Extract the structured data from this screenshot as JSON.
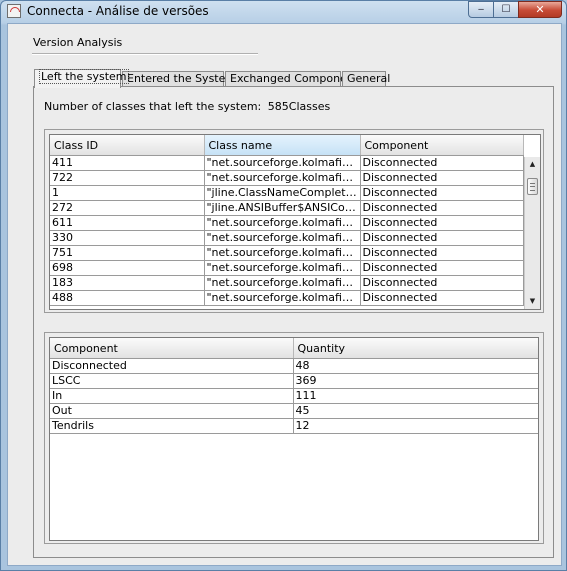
{
  "window": {
    "title": "Connecta - Análise de versões",
    "controls": {
      "minimize": "‒",
      "maximize": "☐",
      "close": "✕"
    }
  },
  "group": {
    "title": "Version Analysis"
  },
  "tabs": [
    {
      "label": "Left the system",
      "active": true
    },
    {
      "label": "Entered the System",
      "active": false
    },
    {
      "label": "Exchanged Component",
      "active": false
    },
    {
      "label": "General",
      "active": false
    }
  ],
  "summary": {
    "label": "Number of classes that left the system:",
    "value": "585Classes"
  },
  "classes_table": {
    "columns": [
      "Class ID",
      "Class name",
      "Component"
    ],
    "sorted_column": "Class name",
    "rows": [
      [
        "411",
        "\"net.sourceforge.kolmafia.Logi…",
        "Disconnected"
      ],
      [
        "722",
        "\"net.sourceforge.kolmafia.Cla…",
        "Disconnected"
      ],
      [
        "1",
        "\"jline.ClassNameCompletor\"",
        "Disconnected"
      ],
      [
        "272",
        "\"jline.ANSIBuffer$ANSICodes\"",
        "Disconnected"
      ],
      [
        "611",
        "\"net.sourceforge.kolmafia.Buff…",
        "Disconnected"
      ],
      [
        "330",
        "\"net.sourceforge.kolmafia.Adv…",
        "Disconnected"
      ],
      [
        "751",
        "\"net.sourceforge.kolmafia.Pro…",
        "Disconnected"
      ],
      [
        "698",
        "\"net.sourceforge.kolmafia.Cak…",
        "Disconnected"
      ],
      [
        "183",
        "\"net.sourceforge.kolmafia.Ite…",
        "Disconnected"
      ],
      [
        "488",
        "\"net.sourceforge.kolmafia.Fam…",
        "Disconnected"
      ]
    ],
    "scroll_position": 0.06
  },
  "components_table": {
    "columns": [
      "Component",
      "Quantity"
    ],
    "rows": [
      [
        "Disconnected",
        "48"
      ],
      [
        "LSCC",
        "369"
      ],
      [
        "In",
        "111"
      ],
      [
        "Out",
        "45"
      ],
      [
        "Tendrils",
        "12"
      ]
    ]
  },
  "icons": {
    "app": "java-app-icon",
    "scroll_up": "▲",
    "scroll_down": "▼"
  }
}
